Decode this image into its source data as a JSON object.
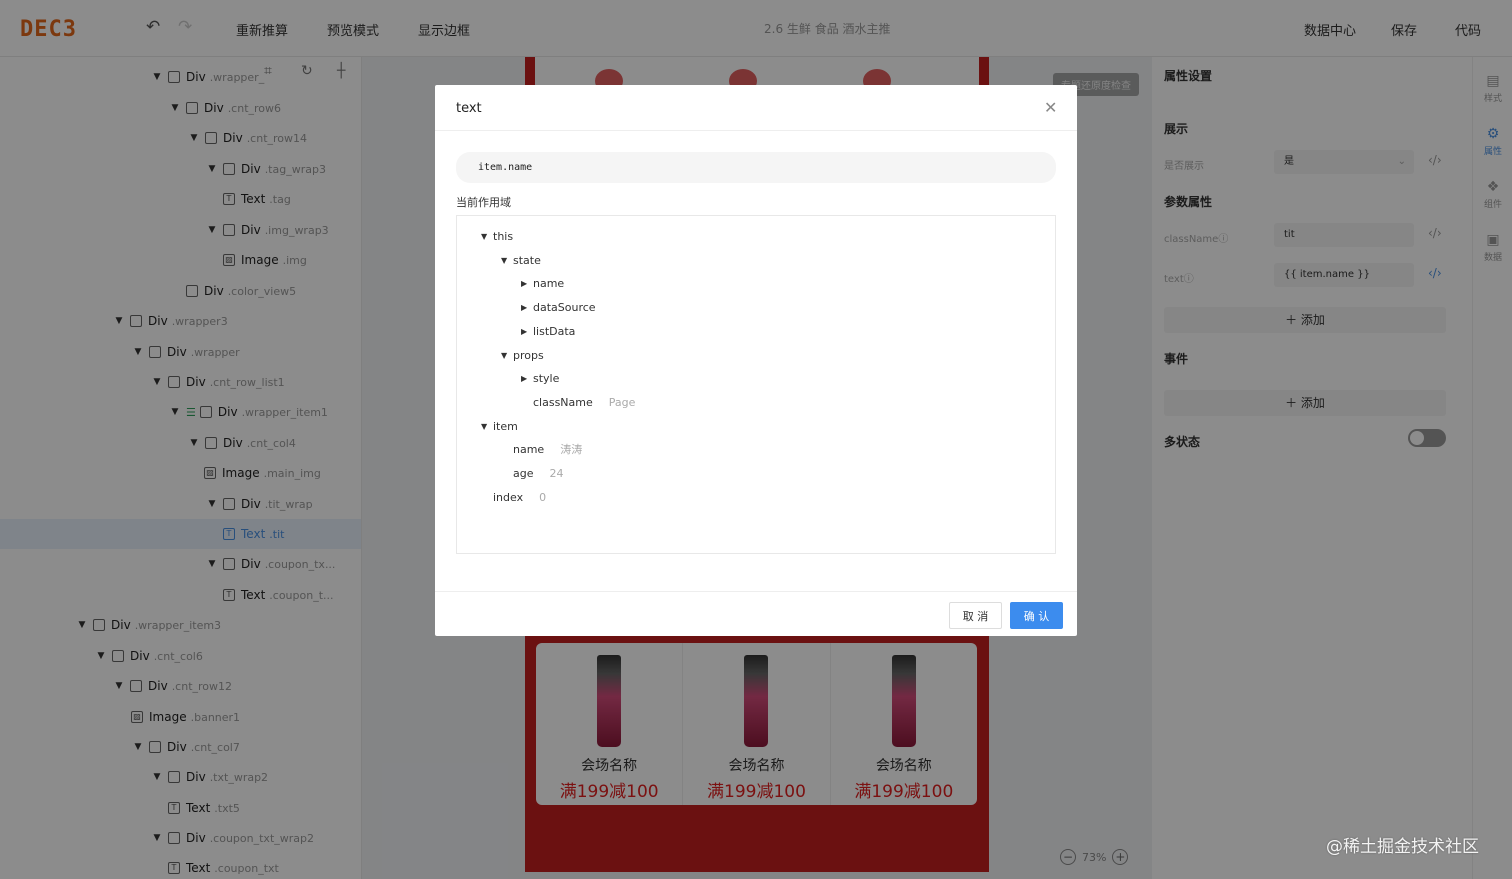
{
  "header": {
    "logo": "DEC3",
    "undo_icon": "undo-icon",
    "redo_icon": "redo-icon",
    "recalc_label": "重新推算",
    "preview_label": "预览模式",
    "border_label": "显示边框",
    "page_name": "2.6 生鲜 食品 酒水主推",
    "data_center_label": "数据中心",
    "save_label": "保存",
    "code_label": "代码"
  },
  "tree": {
    "nodes": [
      {
        "type": "Div",
        "cls": ".wrapper_",
        "icon": "div-icon"
      },
      {
        "type": "Div",
        "cls": ".cnt_row6",
        "icon": "div-icon"
      },
      {
        "type": "Div",
        "cls": ".cnt_row14",
        "icon": "div-icon"
      },
      {
        "type": "Div",
        "cls": ".tag_wrap3",
        "icon": "div-icon"
      },
      {
        "type": "Text",
        "cls": ".tag",
        "icon": "text-icon"
      },
      {
        "type": "Div",
        "cls": ".img_wrap3",
        "icon": "div-icon"
      },
      {
        "type": "Image",
        "cls": ".img",
        "icon": "image-icon"
      },
      {
        "type": "Div",
        "cls": ".color_view5",
        "icon": "div-icon"
      },
      {
        "type": "Div",
        "cls": ".wrapper3",
        "icon": "div-icon"
      },
      {
        "type": "Div",
        "cls": ".wrapper",
        "icon": "div-icon"
      },
      {
        "type": "Div",
        "cls": ".cnt_row_list1",
        "icon": "div-icon"
      },
      {
        "type": "Div",
        "cls": ".wrapper_item1",
        "icon": "div-icon"
      },
      {
        "type": "Div",
        "cls": ".cnt_col4",
        "icon": "div-icon"
      },
      {
        "type": "Image",
        "cls": ".main_img",
        "icon": "image-icon"
      },
      {
        "type": "Div",
        "cls": ".tit_wrap",
        "icon": "div-icon"
      },
      {
        "type": "Text",
        "cls": ".tit",
        "icon": "text-icon"
      },
      {
        "type": "Div",
        "cls": ".coupon_tx...",
        "icon": "div-icon"
      },
      {
        "type": "Text",
        "cls": ".coupon_t...",
        "icon": "text-icon"
      },
      {
        "type": "Div",
        "cls": ".wrapper_item3",
        "icon": "div-icon"
      },
      {
        "type": "Div",
        "cls": ".cnt_col6",
        "icon": "div-icon"
      },
      {
        "type": "Div",
        "cls": ".cnt_row12",
        "icon": "div-icon"
      },
      {
        "type": "Image",
        "cls": ".banner1",
        "icon": "image-icon"
      },
      {
        "type": "Div",
        "cls": ".cnt_col7",
        "icon": "div-icon"
      },
      {
        "type": "Div",
        "cls": ".txt_wrap2",
        "icon": "div-icon"
      },
      {
        "type": "Text",
        "cls": ".txt5",
        "icon": "text-icon"
      },
      {
        "type": "Div",
        "cls": ".coupon_txt_wrap2",
        "icon": "div-icon"
      },
      {
        "type": "Text",
        "cls": ".coupon_txt",
        "icon": "text-icon"
      }
    ]
  },
  "canvas": {
    "preview_button": "专题还原度检查",
    "cards": [
      {
        "name": "会场名称",
        "promo": "满199减100"
      },
      {
        "name": "会场名称",
        "promo": "满199减100"
      },
      {
        "name": "会场名称",
        "promo": "满199减100"
      }
    ],
    "zoom": "73%"
  },
  "right_panel": {
    "title": "属性设置",
    "display_section": "展示",
    "show_label": "是否展示",
    "show_value": "是",
    "params_section": "参数属性",
    "classname_label": "className",
    "classname_value": "tit",
    "text_label": "text",
    "text_value": "{{ item.name }}",
    "add_label": "添加",
    "events_section": "事件",
    "events_add_label": "添加",
    "multistate_label": "多状态",
    "multistate_on": false,
    "tabs": [
      {
        "icon": "style-icon",
        "label": "样式"
      },
      {
        "icon": "gear-icon",
        "label": "属性"
      },
      {
        "icon": "component-icon",
        "label": "组件"
      },
      {
        "icon": "data-icon",
        "label": "数据"
      }
    ]
  },
  "modal": {
    "title": "text",
    "expression": "item.name",
    "scope_label": "当前作用域",
    "scope": {
      "this": "this",
      "state": "state",
      "name": "name",
      "dataSource": "dataSource",
      "listData": "listData",
      "props": "props",
      "style": "style",
      "className_key": "className",
      "className_val": "Page",
      "item": "item",
      "item_name_key": "name",
      "item_name_val": "涛涛",
      "age_key": "age",
      "age_val": "24",
      "index_key": "index",
      "index_val": "0"
    },
    "cancel_label": "取 消",
    "ok_label": "确 认"
  },
  "watermark": "@稀土掘金技术社区",
  "colors": {
    "accent": "#3c8cee",
    "logo": "#e2661a",
    "phone_bg": "#c41f1f",
    "promo": "#e02020"
  }
}
